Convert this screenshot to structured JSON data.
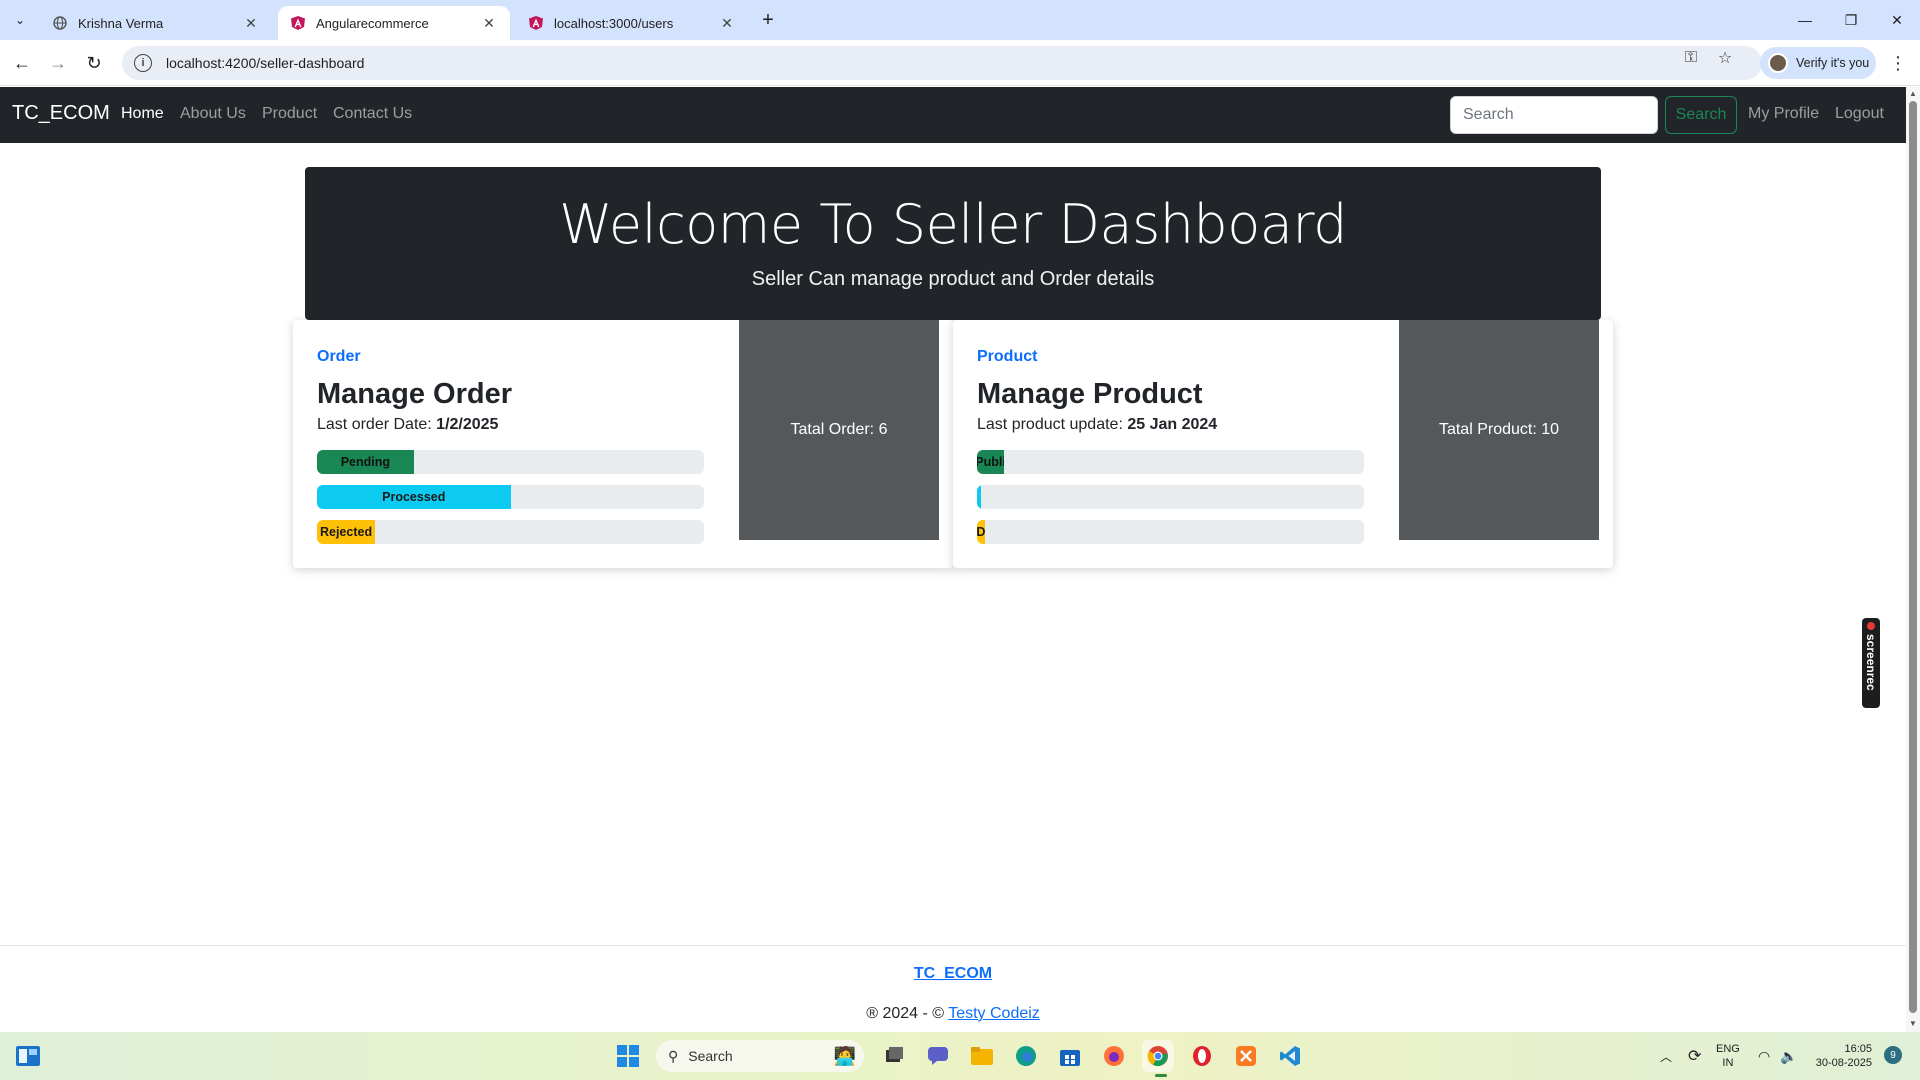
{
  "browser": {
    "tabs": [
      {
        "title": "Krishna Verma",
        "active": false
      },
      {
        "title": "Angularecommerce",
        "active": true
      },
      {
        "title": "localhost:3000/users",
        "active": false
      }
    ],
    "url": "localhost:4200/seller-dashboard",
    "verify_label": "Verify it's you"
  },
  "navbar": {
    "brand": "TC_ECOM",
    "links": [
      "Home",
      "About Us",
      "Product",
      "Contact Us"
    ],
    "search_placeholder": "Search",
    "search_button": "Search",
    "my_profile": "My Profile",
    "logout": "Logout"
  },
  "hero": {
    "title": "Welcome To Seller Dashboard",
    "subtitle": "Seller Can manage product and Order details"
  },
  "order_card": {
    "eyebrow": "Order",
    "title": "Manage Order",
    "sub_label": "Last order Date: ",
    "sub_value": "1/2/2025",
    "bars": [
      {
        "label": "Pending",
        "percent": 25,
        "color": "#198754"
      },
      {
        "label": "Processed",
        "percent": 50,
        "color": "#0dcaf0"
      },
      {
        "label": "Rejected",
        "percent": 15,
        "color": "#ffc107"
      }
    ],
    "panel_text": "Tatal Order: 6"
  },
  "product_card": {
    "eyebrow": "Product",
    "title": "Manage Product",
    "sub_label": "Last product update: ",
    "sub_value": "25 Jan 2024",
    "bars": [
      {
        "label": "Publi",
        "percent": 7,
        "color": "#198754"
      },
      {
        "label": "",
        "percent": 1,
        "color": "#0dcaf0"
      },
      {
        "label": "D",
        "percent": 2,
        "color": "#ffc107"
      }
    ],
    "panel_text": "Tatal Product: 10"
  },
  "footer": {
    "brand": "TC_ECOM",
    "copy_prefix": "® 2024 - © ",
    "copy_link": "Testy Codeiz"
  },
  "screenrec": "screenrec",
  "taskbar": {
    "search_placeholder": "Search",
    "lang_line1": "ENG",
    "lang_line2": "IN",
    "time": "16:05",
    "date": "30-08-2025",
    "notification_count": "9"
  }
}
